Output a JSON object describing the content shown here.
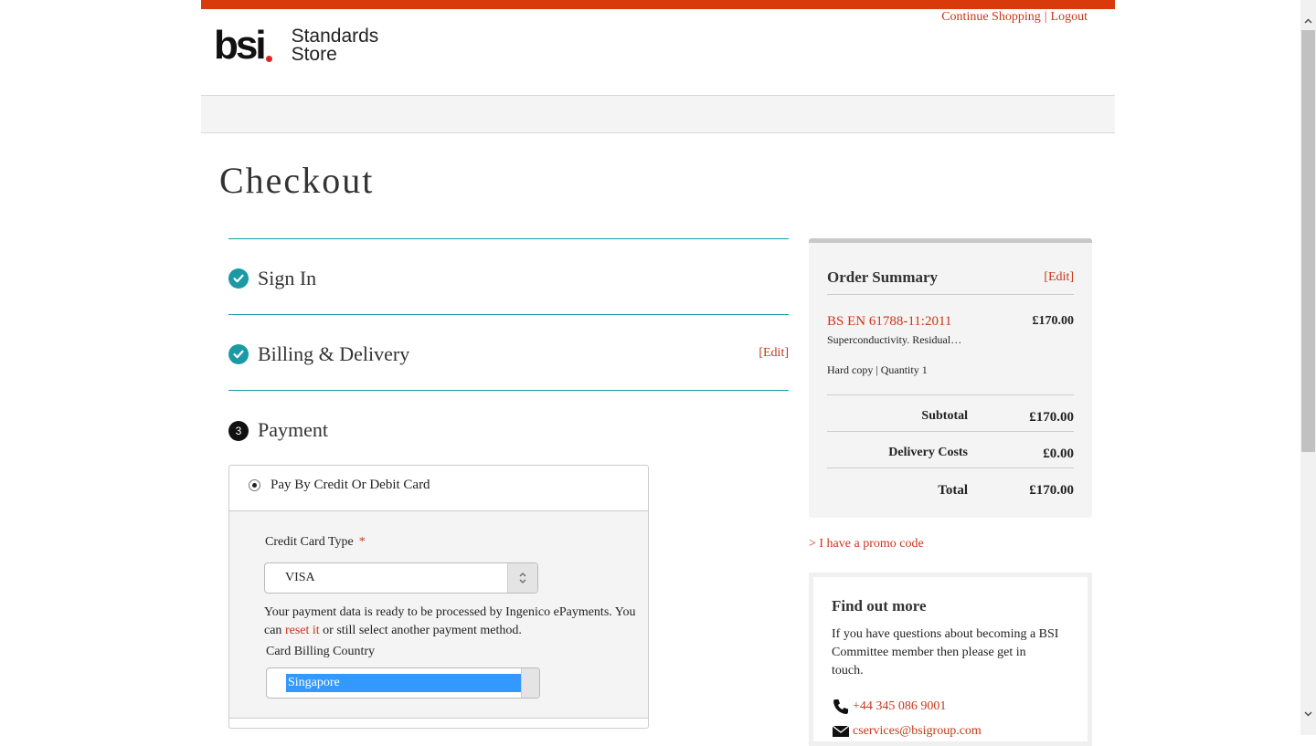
{
  "header": {
    "continue_shopping": "Continue Shopping",
    "separator": "|",
    "logout": "Logout",
    "logo_main": "bsi",
    "logo_line1": "Standards",
    "logo_line2": "Store",
    "accent_color": "#d83a0c"
  },
  "page_title": "Checkout",
  "steps": [
    {
      "label": "Sign In",
      "status": "complete",
      "icon": "check-circle-icon"
    },
    {
      "label": "Billing & Delivery",
      "status": "complete",
      "icon": "check-circle-icon",
      "edit": "[Edit]"
    },
    {
      "label": "Payment",
      "status": "current",
      "number": "3"
    }
  ],
  "payment": {
    "method_label": "Pay By Credit Or Debit Card",
    "card_type_label": "Credit Card Type",
    "required_mark": "*",
    "card_type_value": "VISA",
    "info_text_1": "Your payment data is ready to be processed by Ingenico ePayments. You can ",
    "info_link": "reset it",
    "info_text_2": " or still select another payment method.",
    "country_label": "Card Billing Country",
    "country_value": "Singapore"
  },
  "order_summary": {
    "title": "Order Summary",
    "edit": "[Edit]",
    "product_name": "BS EN 61788-11:2011",
    "product_price": "£170.00",
    "product_desc": "Superconductivity. Residual…",
    "product_format": "Hard copy",
    "product_qty": "Quantity 1",
    "subtotal_label": "Subtotal",
    "subtotal_value": "£170.00",
    "delivery_label": "Delivery Costs",
    "delivery_value": "£0.00",
    "total_label": "Total",
    "total_value": "£170.00"
  },
  "promo_link": "> I have a promo code",
  "find_out_more": {
    "title": "Find out more",
    "text": "If you have questions about becoming a BSI Committee member then please get in touch.",
    "phone": "+44 345 086 9001",
    "email": "cservices@bsigroup.com"
  }
}
